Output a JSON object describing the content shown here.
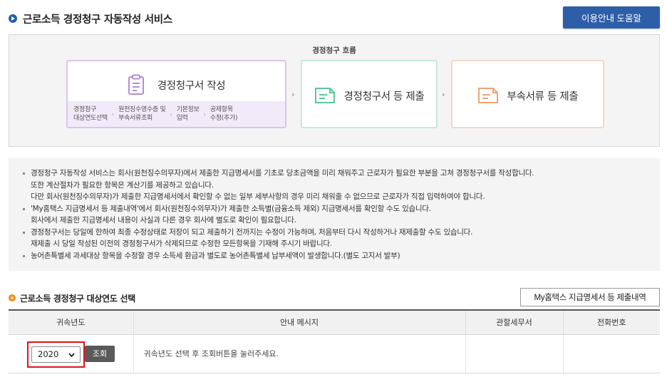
{
  "header": {
    "title": "근로소득 경정청구 자동작성 서비스",
    "help_button": "이용안내 도움말"
  },
  "flow": {
    "title": "경정청구 흐름",
    "steps": [
      {
        "label": "경정청구서 작성",
        "substeps": [
          [
            "경정청구",
            "대상연도선택"
          ],
          [
            "원천징수영수증 및",
            "부속서류조회"
          ],
          [
            "기본정보",
            "입력"
          ],
          [
            "공제항목",
            "수정(추가)"
          ]
        ]
      },
      {
        "label": "경정청구서 등 제출"
      },
      {
        "label": "부속서류 등 제출"
      }
    ],
    "arrow": "›"
  },
  "notes": [
    [
      "경정청구 자동작성 서비스는 회사(원천징수의무자)에서 제출한 지급명세서를 기초로 당초금액을 미리 채워주고 근로자가 필요한 부분을 고쳐 경정청구서를 작성합니다.",
      "또한 계산절차가 필요한 항목은 계산기를 제공하고 있습니다.",
      "다만 회사(원천징수의무자)가 제출한 지급명세서에서 확인할 수 없는 일부 세부사항의 경우 미리 채워줄 수 없으므로 근로자가 직접 입력하여야 합니다."
    ],
    [
      "'My홈택스 지급명세서 등 제출내역'에서 회사(원천징수의무자)가 제출한 소득별(금융소득 제외) 지급명세서를 확인할 수도 있습니다.",
      "회사에서 제출한 지급명세서 내용이 사실과 다른 경우 회사에 별도로 확인이 필요합니다."
    ],
    [
      "경정청구서는 당일에 한하여 최종 수정상태로 저장이 되고 제출하기 전까지는 수정이 가능하며, 처음부터 다시 작성하거나 재제출할 수도 있습니다.",
      "재제출 시 당일 작성된 이전의 경정청구서가 삭제되므로 수정한 모든항목을 기재해 주시기 바랍니다."
    ],
    [
      "농어촌특별세 과세대상 항목을 수정할 경우 소득세 환급과 별도로 농어촌특별세 납부세액이 발생합니다.(별도 고지서 발부)"
    ]
  ],
  "section": {
    "title": "근로소득 경정청구 대상연도 선택",
    "history_button": "My홈택스 지급명세서 등 제출내역"
  },
  "table": {
    "headers": [
      "귀속년도",
      "안내 메시지",
      "관할세무서",
      "전화번호"
    ],
    "row": {
      "year": "2020",
      "search_button": "조회",
      "message": "귀속년도 선택 후 조회버튼을 눌러주세요.",
      "tax_office": "",
      "phone": ""
    }
  }
}
